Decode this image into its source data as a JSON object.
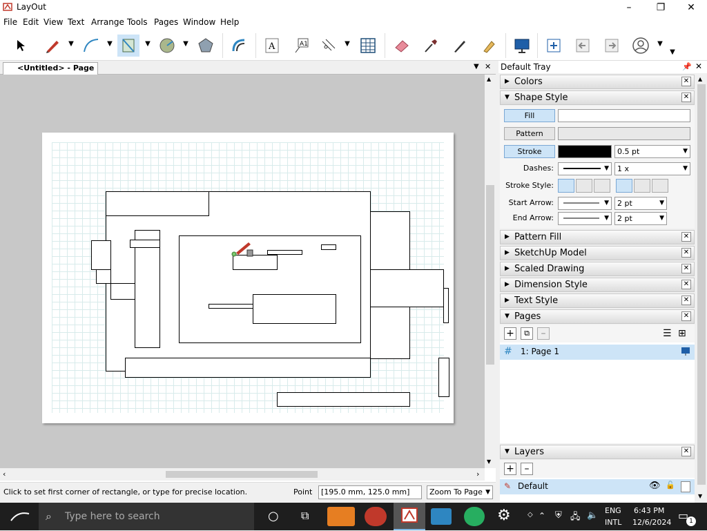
{
  "window": {
    "title": "LayOut",
    "minimize": "–",
    "maximize": "❐",
    "close": "✕"
  },
  "menu": [
    "File",
    "Edit",
    "View",
    "Text",
    "Arrange",
    "Tools",
    "Pages",
    "Window",
    "Help"
  ],
  "toolbar": {
    "icons": [
      "select-icon",
      "pencil-icon",
      "arc-icon",
      "rectangle-icon",
      "circle-icon",
      "polygon-icon",
      "offset-icon",
      "text-icon",
      "label-icon",
      "dimension-icon",
      "table-icon",
      "eraser-icon",
      "eyedropper-icon",
      "split-icon",
      "join-icon",
      "presentation-icon",
      "add-page-icon",
      "previous-page-icon",
      "next-page-icon",
      "account-icon"
    ]
  },
  "document": {
    "tab_label": "<Untitled> - Page 1"
  },
  "tray": {
    "title": "Default Tray",
    "panels": {
      "colors": "Colors",
      "shape_style": "Shape Style",
      "pattern_fill": "Pattern Fill",
      "sketchup_model": "SketchUp Model",
      "scaled_drawing": "Scaled Drawing",
      "dimension_style": "Dimension Style",
      "text_style": "Text Style",
      "pages": "Pages",
      "layers": "Layers"
    },
    "shape_style": {
      "fill_label": "Fill",
      "pattern_label": "Pattern",
      "stroke_label": "Stroke",
      "stroke_color": "#000000",
      "stroke_width": "0.5 pt",
      "dashes_label": "Dashes:",
      "dashes_scale": "1 x",
      "stroke_style_label": "Stroke Style:",
      "start_arrow_label": "Start Arrow:",
      "start_arrow_size": "2 pt",
      "end_arrow_label": "End Arrow:",
      "end_arrow_size": "2 pt"
    },
    "pages": {
      "items": [
        {
          "label": "1:  Page 1",
          "symbol": "#"
        }
      ]
    },
    "layers": {
      "items": [
        {
          "label": "Default"
        }
      ]
    }
  },
  "status": {
    "hint": "Click to set first corner of rectangle, or type for precise location.",
    "point_label": "Point",
    "point_value": "[195.0 mm, 125.0 mm]",
    "zoom": "Zoom To Page"
  },
  "taskbar": {
    "search_placeholder": "Type here to search",
    "lang_top": "ENG",
    "lang_bottom": "INTL",
    "time": "6:43 PM",
    "date": "12/6/2024",
    "notification_count": "1"
  }
}
